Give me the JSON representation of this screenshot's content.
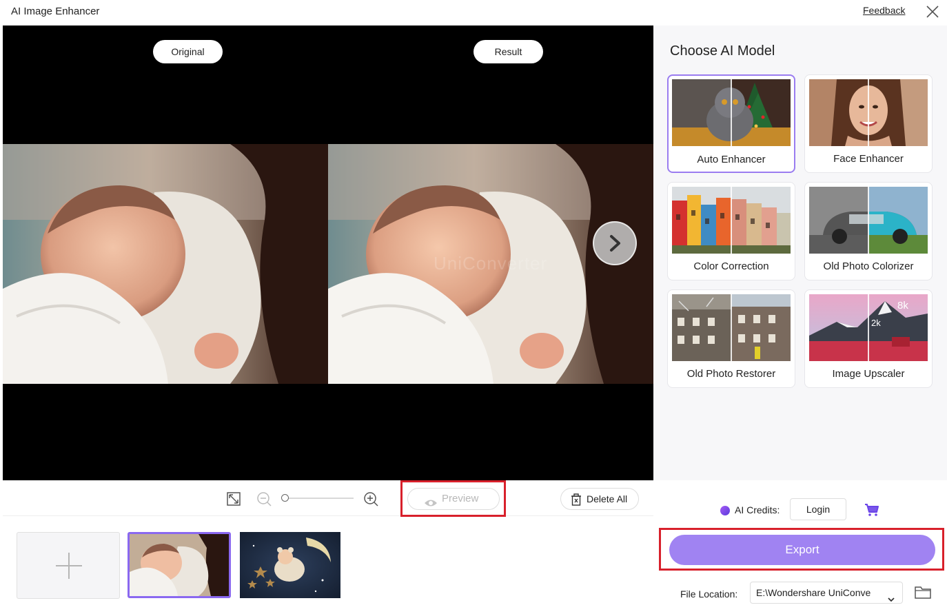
{
  "window": {
    "title": "AI Image Enhancer",
    "feedback_label": "Feedback"
  },
  "preview": {
    "original_label": "Original",
    "result_label": "Result",
    "watermark": "UniConverter"
  },
  "toolbar": {
    "preview_label": "Preview",
    "delete_all_label": "Delete All",
    "zoom_level": 0
  },
  "panel": {
    "title": "Choose AI Model",
    "models": [
      {
        "label": "Auto Enhancer",
        "selected": true
      },
      {
        "label": "Face Enhancer",
        "selected": false
      },
      {
        "label": "Color Correction",
        "selected": false
      },
      {
        "label": "Old Photo Colorizer",
        "selected": false
      },
      {
        "label": "Old Photo Restorer",
        "selected": false
      },
      {
        "label": "Image Upscaler",
        "selected": false
      }
    ],
    "upscale_badge_small": "2k",
    "upscale_badge_large": "8k"
  },
  "footer": {
    "credits_label": "AI Credits:",
    "login_label": "Login",
    "export_label": "Export",
    "file_location_label": "File Location:",
    "file_location_value": "E:\\Wondershare UniConve"
  },
  "colors": {
    "accent": "#a083f2",
    "selected_border": "#9a7cf0",
    "highlight": "#d8202b"
  }
}
